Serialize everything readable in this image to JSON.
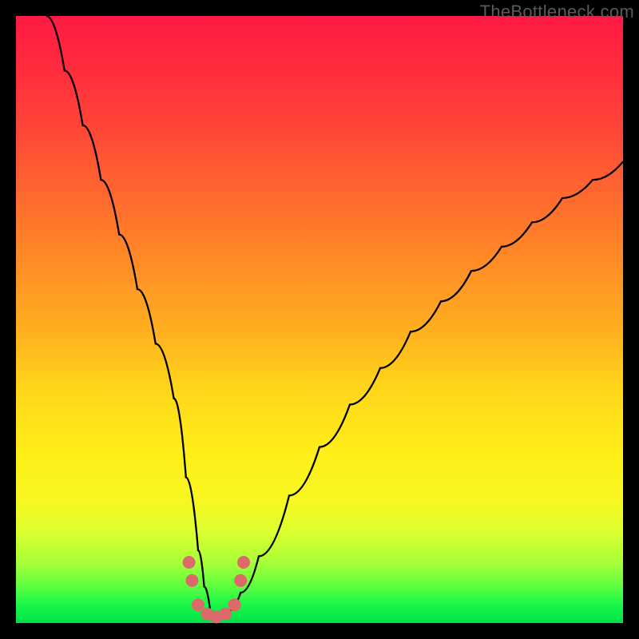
{
  "watermark": "TheBottleneck.com",
  "colors": {
    "frame": "#000000",
    "curve": "#000000",
    "marker": "#dd6a6a",
    "gradient_top": "#ff1a44",
    "gradient_bottom": "#00e048"
  },
  "chart_data": {
    "type": "line",
    "title": "",
    "xlabel": "",
    "ylabel": "",
    "xlim": [
      0,
      100
    ],
    "ylim": [
      0,
      100
    ],
    "grid": false,
    "legend": false,
    "note": "V-shaped bottleneck curve: minimum near x≈32; y=0 is bottom (green), y=100 is top (red). Values estimated from pixel positions.",
    "series": [
      {
        "name": "bottleneck-curve",
        "x": [
          5,
          8,
          11,
          14,
          17,
          20,
          23,
          26,
          28,
          30,
          31,
          32,
          33,
          34,
          35,
          37,
          40,
          45,
          50,
          55,
          60,
          65,
          70,
          75,
          80,
          85,
          90,
          95,
          100
        ],
        "y": [
          100,
          91,
          82,
          73,
          64,
          55,
          46,
          37,
          24,
          12,
          6,
          2,
          1,
          1,
          2,
          5,
          11,
          21,
          29,
          36,
          42,
          48,
          53,
          58,
          62,
          66,
          70,
          73,
          76
        ]
      }
    ],
    "markers": {
      "name": "near-minimum-points",
      "x": [
        28.5,
        29.0,
        30.0,
        31.5,
        33.0,
        34.5,
        36.0,
        37.0,
        37.5
      ],
      "y": [
        10.0,
        7.0,
        3.0,
        1.5,
        1.0,
        1.5,
        3.0,
        7.0,
        10.0
      ]
    }
  }
}
